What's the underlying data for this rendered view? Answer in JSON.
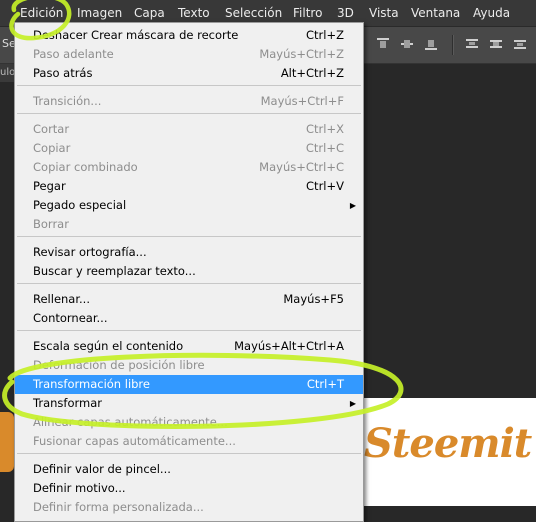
{
  "menubar": {
    "items": [
      "Edición",
      "Imagen",
      "Capa",
      "Texto",
      "Selección",
      "Filtro",
      "3D",
      "Vista",
      "Ventana",
      "Ayuda"
    ]
  },
  "toolbar": {
    "left_text": "Se",
    "tab_text": "ulo"
  },
  "edit_menu": {
    "items": [
      {
        "label": "Deshacer Crear máscara de recorte",
        "shortcut": "Ctrl+Z"
      },
      {
        "label": "Paso adelante",
        "shortcut": "Mayús+Ctrl+Z"
      },
      {
        "label": "Paso atrás",
        "shortcut": "Alt+Ctrl+Z"
      },
      {
        "label": "Transición...",
        "shortcut": "Mayús+Ctrl+F"
      },
      {
        "label": "Cortar",
        "shortcut": "Ctrl+X"
      },
      {
        "label": "Copiar",
        "shortcut": "Ctrl+C"
      },
      {
        "label": "Copiar combinado",
        "shortcut": "Mayús+Ctrl+C"
      },
      {
        "label": "Pegar",
        "shortcut": "Ctrl+V"
      },
      {
        "label": "Pegado especial",
        "shortcut": ""
      },
      {
        "label": "Borrar",
        "shortcut": ""
      },
      {
        "label": "Revisar ortografía...",
        "shortcut": ""
      },
      {
        "label": "Buscar y reemplazar texto...",
        "shortcut": ""
      },
      {
        "label": "Rellenar...",
        "shortcut": "Mayús+F5"
      },
      {
        "label": "Contornear...",
        "shortcut": ""
      },
      {
        "label": "Escala según el contenido",
        "shortcut": "Mayús+Alt+Ctrl+A"
      },
      {
        "label": "Deformación de posición libre",
        "shortcut": ""
      },
      {
        "label": "Transformación libre",
        "shortcut": "Ctrl+T"
      },
      {
        "label": "Transformar",
        "shortcut": ""
      },
      {
        "label": "Alinear capas automáticamente...",
        "shortcut": ""
      },
      {
        "label": "Fusionar capas automáticamente...",
        "shortcut": ""
      },
      {
        "label": "Definir valor de pincel...",
        "shortcut": ""
      },
      {
        "label": "Definir motivo...",
        "shortcut": ""
      },
      {
        "label": "Definir forma personalizada...",
        "shortcut": ""
      }
    ]
  },
  "canvas": {
    "logo_text": "Steemit"
  },
  "colors": {
    "highlight": "#3399ff",
    "annotation": "#c6f028",
    "logo_orange": "#d98a2b"
  }
}
